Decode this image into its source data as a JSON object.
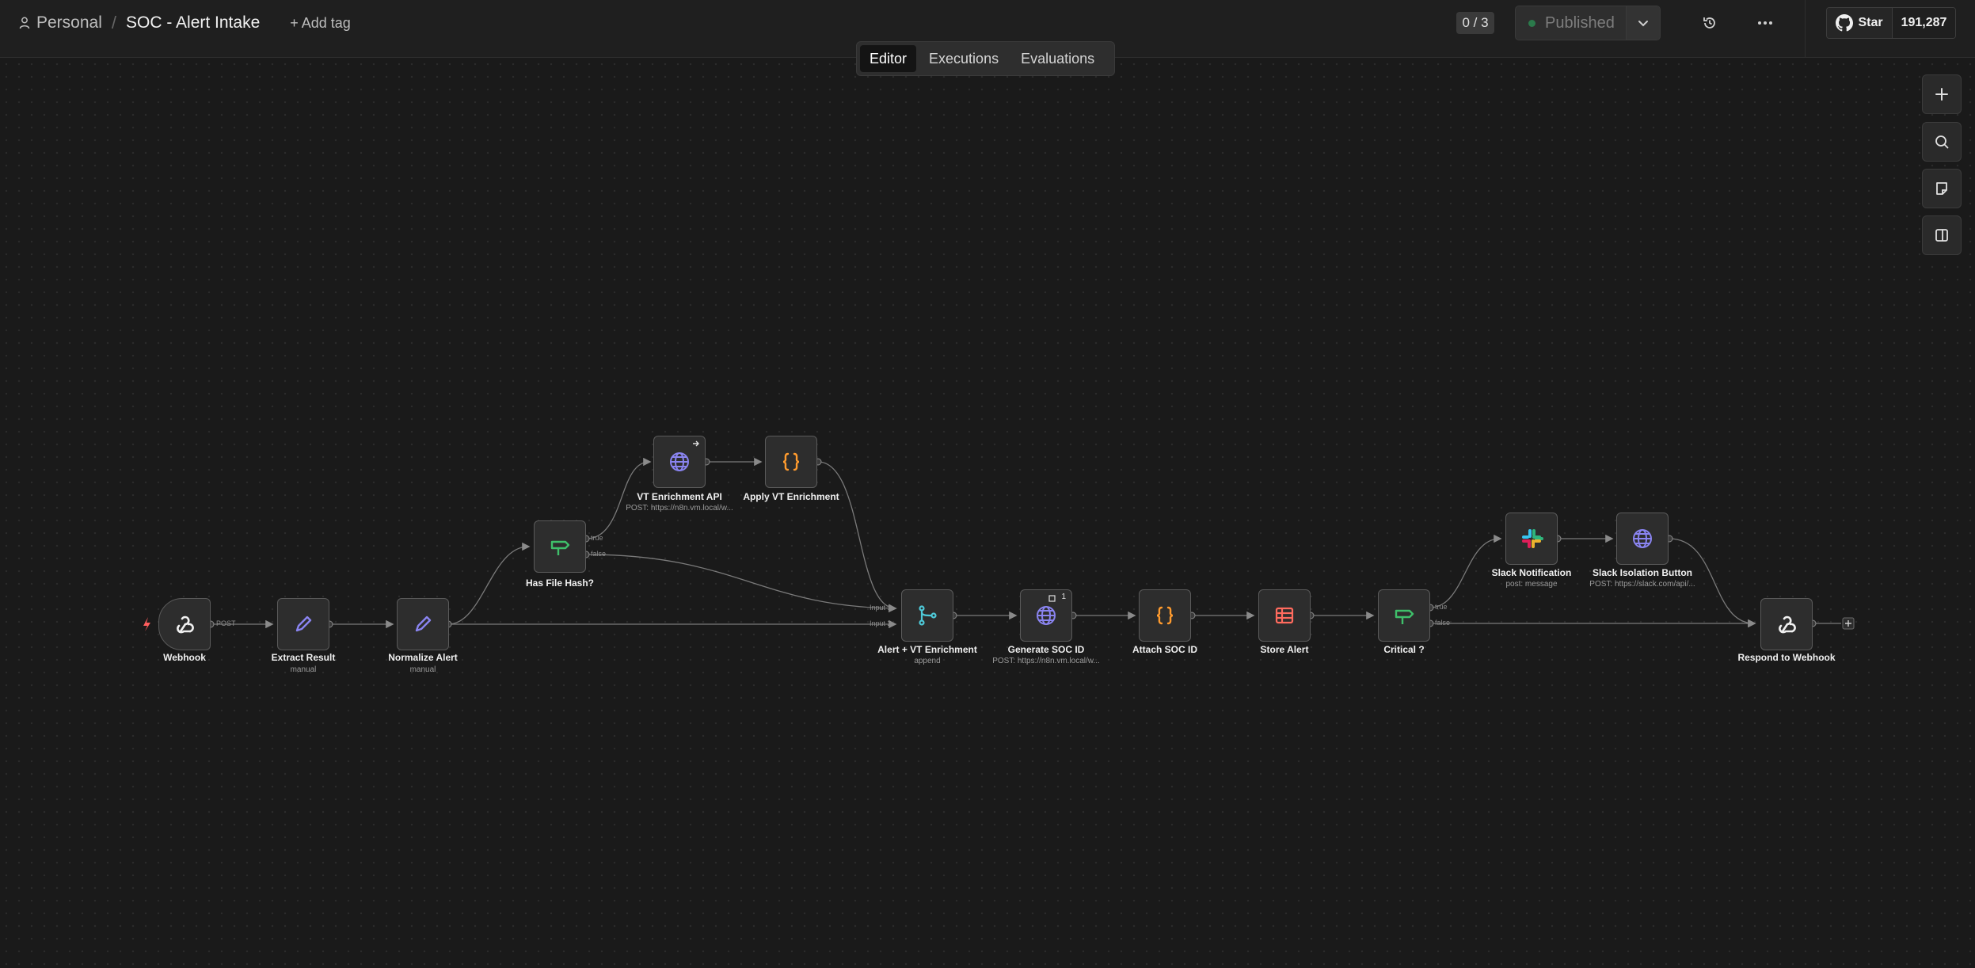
{
  "header": {
    "workspace": "Personal",
    "separator": "/",
    "workflow_title": "SOC - Alert Intake",
    "add_tag": "+ Add tag",
    "counter": "0 / 3",
    "publish_label": "Published",
    "github_star": "Star",
    "github_count": "191,287"
  },
  "tabs": [
    {
      "label": "Editor",
      "active": true
    },
    {
      "label": "Executions",
      "active": false
    },
    {
      "label": "Evaluations",
      "active": false
    }
  ],
  "nodes": {
    "webhook": {
      "label": "Webhook",
      "port": "POST"
    },
    "extract": {
      "label": "Extract Result",
      "sub": "manual"
    },
    "normalize": {
      "label": "Normalize Alert",
      "sub": "manual"
    },
    "hasfile": {
      "label": "Has File Hash?",
      "true": "true",
      "false": "false"
    },
    "vtapi": {
      "label": "VT Enrichment API",
      "sub": "POST: https://n8n.vm.local/w..."
    },
    "applyvt": {
      "label": "Apply VT Enrichment"
    },
    "merge": {
      "label": "Alert + VT Enrichment",
      "sub": "append",
      "in1": "Input 1",
      "in2": "Input 2"
    },
    "gensoc": {
      "label": "Generate SOC ID",
      "sub": "POST: https://n8n.vm.local/w...",
      "badge": "1"
    },
    "attachsoc": {
      "label": "Attach SOC ID"
    },
    "store": {
      "label": "Store Alert"
    },
    "critical": {
      "label": "Critical ?",
      "true": "true",
      "false": "false"
    },
    "slacknotif": {
      "label": "Slack Notification",
      "sub": "post: message"
    },
    "slackiso": {
      "label": "Slack Isolation Button",
      "sub": "POST: https://slack.com/api/..."
    },
    "respond": {
      "label": "Respond to Webhook"
    }
  },
  "colors": {
    "accent_purple": "#8a84f0",
    "code_orange": "#ff9b2e",
    "if_green": "#3fbf6a",
    "merge_cyan": "#4ec9d8",
    "table_red": "#ff6b5e"
  }
}
